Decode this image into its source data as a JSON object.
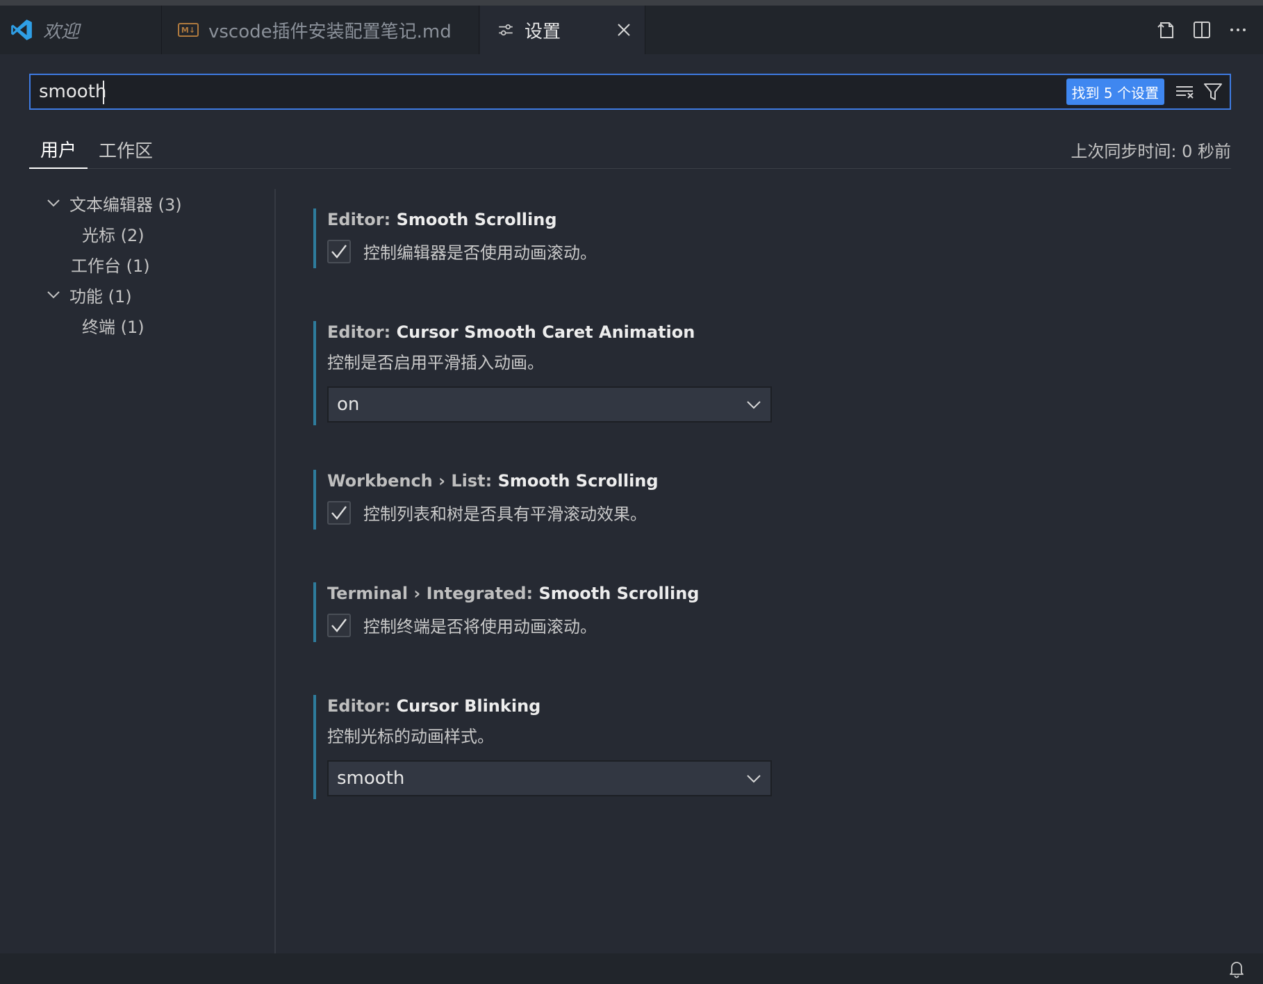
{
  "tabs": {
    "welcome": {
      "label": "欢迎"
    },
    "markdown": {
      "label": "vscode插件安装配置笔记.md",
      "file_type": "M↓"
    },
    "settings": {
      "label": "设置"
    }
  },
  "search": {
    "value": "smooth",
    "result_count_label": "找到 5 个设置"
  },
  "scope": {
    "user_label": "用户",
    "workspace_label": "工作区",
    "sync_status": "上次同步时间: 0 秒前"
  },
  "toc": [
    {
      "label": "文本编辑器 (3)",
      "expanded": true
    },
    {
      "label": "光标 (2)"
    },
    {
      "label": "工作台 (1)"
    },
    {
      "label": "功能 (1)",
      "expanded": true
    },
    {
      "label": "终端 (1)"
    }
  ],
  "settings": [
    {
      "category": "Editor: ",
      "name": "Smooth Scrolling",
      "type": "checkbox",
      "checked": true,
      "description": "控制编辑器是否使用动画滚动。"
    },
    {
      "category": "Editor: ",
      "name": "Cursor Smooth Caret Animation",
      "type": "select",
      "description": "控制是否启用平滑插入动画。",
      "value": "on"
    },
    {
      "category": "Workbench › List: ",
      "name": "Smooth Scrolling",
      "type": "checkbox",
      "checked": true,
      "description": "控制列表和树是否具有平滑滚动效果。"
    },
    {
      "category": "Terminal › Integrated: ",
      "name": "Smooth Scrolling",
      "type": "checkbox",
      "checked": true,
      "description": "控制终端是否将使用动画滚动。"
    },
    {
      "category": "Editor: ",
      "name": "Cursor Blinking",
      "type": "select",
      "description": "控制光标的动画样式。",
      "value": "smooth"
    }
  ],
  "colors": {
    "accent": "#3f87f0",
    "modified_bar": "#2e7c9c",
    "background": "#262a33"
  }
}
